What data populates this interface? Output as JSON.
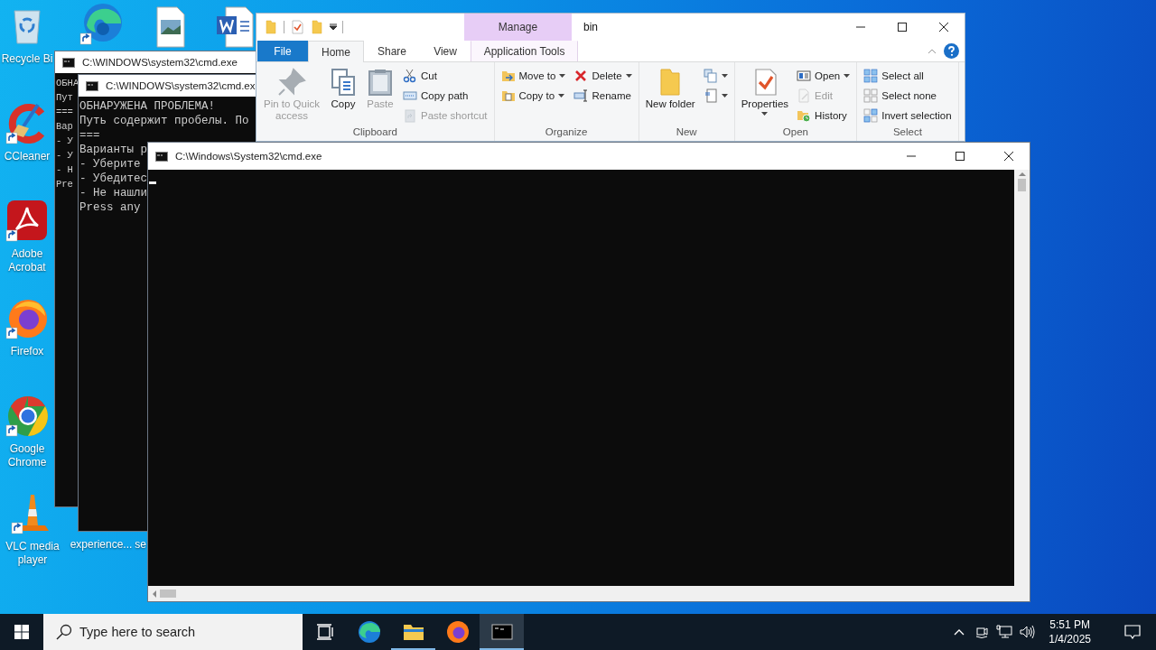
{
  "desktop_icons": [
    {
      "kind": "recycle",
      "label": "Recycle Bi"
    },
    {
      "kind": "edge"
    },
    {
      "kind": "image"
    },
    {
      "kind": "word"
    },
    {
      "kind": "ccleaner",
      "label": "CCleaner"
    },
    {
      "kind": "acrobat",
      "label": "Adobe Acrobat"
    },
    {
      "kind": "firefox",
      "label": "Firefox"
    },
    {
      "kind": "chrome",
      "label": "Google Chrome"
    },
    {
      "kind": "vlc",
      "label": "VLC media player"
    },
    {
      "kind": "none",
      "label": "experience..."
    },
    {
      "kind": "none",
      "label": "se"
    }
  ],
  "console_windows": [
    {
      "kind": "partial",
      "title": "C:\\WINDOWS\\system32\\cmd.exe",
      "lines": [
        "ОБНА",
        "Пут",
        "===",
        "Вар",
        "- У",
        "- У",
        "- Н",
        "Pre"
      ]
    },
    {
      "kind": "partial",
      "title": "C:\\WINDOWS\\system32\\cmd.ex",
      "lines": [
        "ОБНАРУЖЕНА ПРОБЛЕМА!",
        "Путь содержит пробелы. По",
        "===",
        "Варианты р",
        "- Уберите",
        "- Убедитес",
        "- Не нашли",
        "Press any"
      ]
    },
    {
      "kind": "full",
      "title": "C:\\Windows\\System32\\cmd.exe",
      "cursor": true
    }
  ],
  "explorer": {
    "title": "bin",
    "context_header": "Manage",
    "tabs": [
      {
        "kind": "file",
        "label": "File",
        "selected": false
      },
      {
        "kind": "tab",
        "label": "Home",
        "selected": true
      },
      {
        "kind": "tab",
        "label": "Share",
        "selected": false
      },
      {
        "kind": "tab",
        "label": "View",
        "selected": false
      },
      {
        "kind": "context",
        "label": "Application Tools",
        "selected": false
      }
    ],
    "groups": [
      {
        "label": "Clipboard",
        "columns": [
          [
            {
              "kind": "large",
              "label": "Pin to Quick access",
              "disabled": true
            }
          ],
          [
            {
              "kind": "large",
              "label": "Copy",
              "disabled": false
            }
          ],
          [
            {
              "kind": "large",
              "label": "Paste",
              "disabled": true
            }
          ],
          [
            {
              "kind": "small",
              "label": "Cut",
              "disabled": false
            },
            {
              "kind": "small",
              "label": "Copy path",
              "disabled": false
            },
            {
              "kind": "small",
              "label": "Paste shortcut",
              "disabled": true
            }
          ]
        ]
      },
      {
        "label": "Organize",
        "columns": [
          [
            {
              "kind": "small",
              "label": "Move to",
              "dropdown": true,
              "disabled": false
            },
            {
              "kind": "small",
              "label": "Copy to",
              "dropdown": true,
              "disabled": false
            }
          ],
          [
            {
              "kind": "small",
              "label": "Delete",
              "dropdown": true,
              "disabled": false
            },
            {
              "kind": "small",
              "label": "Rename",
              "disabled": false
            }
          ]
        ]
      },
      {
        "label": "New",
        "columns": [
          [
            {
              "kind": "large",
              "label": "New folder",
              "disabled": false
            }
          ],
          [
            {
              "kind": "iconbutton",
              "dropdown": true,
              "disabled": false
            },
            {
              "kind": "iconbutton",
              "dropdown": true,
              "disabled": false
            }
          ]
        ]
      },
      {
        "label": "Open",
        "columns": [
          [
            {
              "kind": "large",
              "label": "Properties",
              "dropdown": true,
              "disabled": false
            }
          ],
          [
            {
              "kind": "small",
              "label": "Open",
              "dropdown": true,
              "disabled": false
            },
            {
              "kind": "small",
              "label": "Edit",
              "disabled": true
            },
            {
              "kind": "small",
              "label": "History",
              "disabled": false
            }
          ]
        ]
      },
      {
        "label": "Select",
        "columns": [
          [
            {
              "kind": "small",
              "label": "Select all",
              "disabled": false
            },
            {
              "kind": "small",
              "label": "Select none",
              "disabled": false
            },
            {
              "kind": "small",
              "label": "Invert selection",
              "disabled": false
            }
          ]
        ]
      }
    ]
  },
  "taskbar": {
    "search": {
      "placeholder": "Type here to search"
    },
    "apps": [
      {
        "kind": "taskview",
        "open": false,
        "selected": false
      },
      {
        "kind": "edge",
        "open": false,
        "selected": false
      },
      {
        "kind": "explorer",
        "open": true,
        "selected": false
      },
      {
        "kind": "firefox",
        "open": false,
        "selected": false
      },
      {
        "kind": "console",
        "open": true,
        "selected": true
      }
    ],
    "clock": {
      "time": "5:51 PM",
      "date": "1/4/2025"
    }
  }
}
